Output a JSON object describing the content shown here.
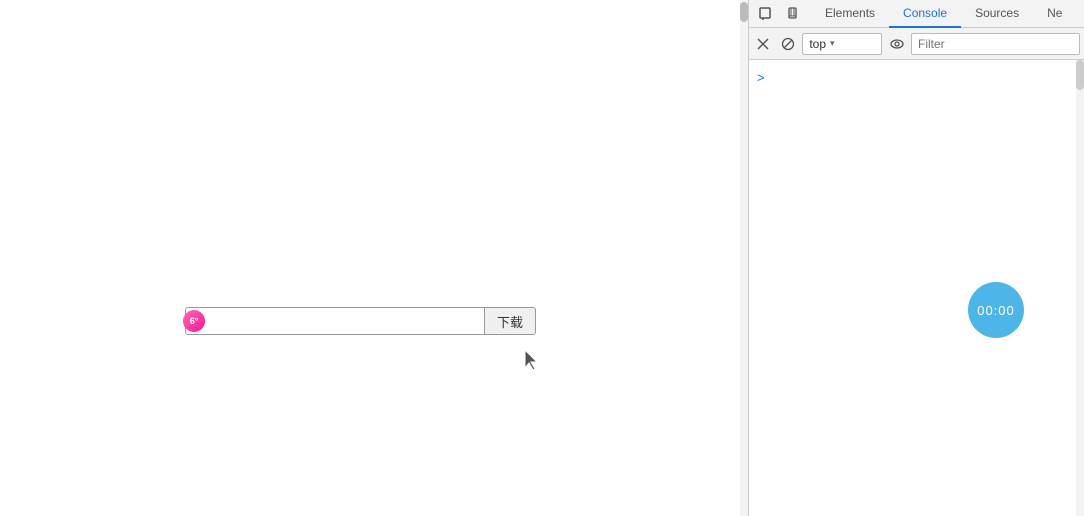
{
  "browser": {
    "input_placeholder": "",
    "input_value": "",
    "download_button_label": "下载"
  },
  "devtools": {
    "tabs": [
      {
        "id": "elements",
        "label": "Elements",
        "active": false
      },
      {
        "id": "console",
        "label": "Console",
        "active": true
      },
      {
        "id": "sources",
        "label": "Sources",
        "active": false
      },
      {
        "id": "network",
        "label": "Ne",
        "active": false
      }
    ],
    "toolbar": {
      "context_value": "top",
      "filter_placeholder": "Filter"
    },
    "timer": {
      "display": "00:00"
    },
    "console_prompt": ">"
  },
  "icons": {
    "inspect": "⬚",
    "device": "⬜",
    "play": "▶",
    "ban": "⊘",
    "chevron_down": "▾",
    "eye": "◉",
    "chevron_right": "›"
  }
}
